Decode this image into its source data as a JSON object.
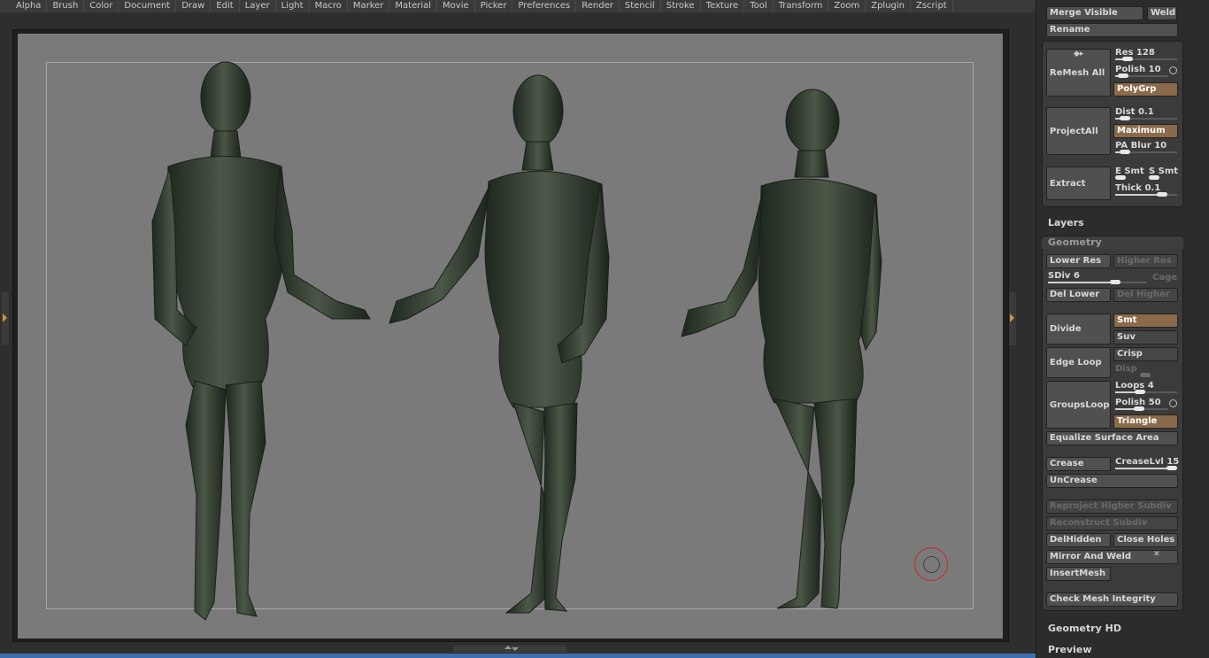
{
  "menu": [
    "Alpha",
    "Brush",
    "Color",
    "Document",
    "Draw",
    "Edit",
    "Layer",
    "Light",
    "Macro",
    "Marker",
    "Material",
    "Movie",
    "Picker",
    "Preferences",
    "Render",
    "Stencil",
    "Stroke",
    "Texture",
    "Tool",
    "Transform",
    "Zoom",
    "Zplugin",
    "Zscript"
  ],
  "panel": {
    "merge_visible": "Merge Visible",
    "weld": "Weld",
    "rename": "Rename",
    "remesh_all": "ReMesh  All",
    "res_label": "Res",
    "res_value": "128",
    "res_level": 0.2,
    "polish_label": "Polish",
    "polish_value": "10",
    "polish_level": 0.15,
    "polygrp": "PolyGrp",
    "project_all": "ProjectAll",
    "dist_label": "Dist",
    "dist_value": "0.1",
    "dist_level": 0.15,
    "maximum": "Maximum",
    "pa_blur_label": "PA  Blur",
    "pa_blur_value": "10",
    "pa_blur_level": 0.15,
    "extract": "Extract",
    "e_smt": "E  Smt",
    "s_smt": "S  Smt",
    "thick_label": "Thick",
    "thick_value": "0.1",
    "thick_level": 0.75,
    "layers": "Layers",
    "geometry": "Geometry",
    "lower_res": "Lower Res",
    "higher_res": "Higher Res",
    "sdiv_label": "SDiv",
    "sdiv_value": "6",
    "sdiv_level": 0.68,
    "cage": "Cage",
    "del_lower": "Del Lower",
    "del_higher": "Del Higher",
    "divide": "Divide",
    "smt": "Smt",
    "suv": "Suv",
    "edge_loop": "Edge Loop",
    "crisp": "Crisp",
    "disp": "Disp",
    "groups_loops": "GroupsLoops",
    "loops_label": "Loops",
    "loops_value": "4",
    "loops_level": 0.4,
    "polish2_label": "Polish",
    "polish2_value": "50",
    "polish2_level": 0.45,
    "triangle": "Triangle",
    "equalize": "Equalize Surface Area",
    "crease": "Crease",
    "crease_lvl_label": "CreaseLvl",
    "crease_lvl_value": "15",
    "crease_lvl_level": 0.92,
    "uncrease": "UnCrease",
    "reproject": "Reproject Higher Subdiv",
    "reconstruct": "Reconstruct Subdiv",
    "del_hidden": "DelHidden",
    "close_holes": "Close Holes",
    "mirror_weld": "Mirror And Weld",
    "insert_mesh": "InsertMesh",
    "check_mesh": "Check Mesh Integrity",
    "geometry_hd": "Geometry HD",
    "preview": "Preview"
  },
  "colors": {
    "canvas": "#7a7a7a",
    "bronze": "#2f3a30",
    "accent": "#8a6a4a",
    "cursor": "#c9262a"
  }
}
